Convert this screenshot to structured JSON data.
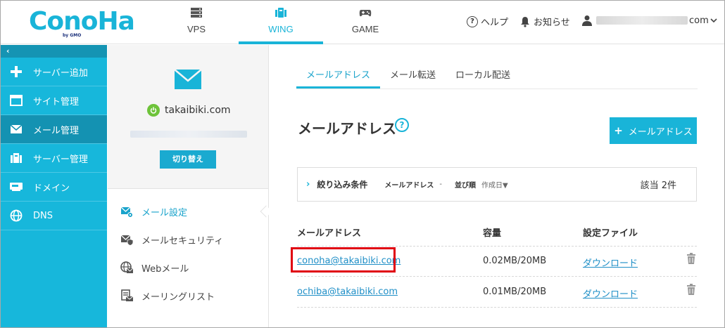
{
  "header": {
    "logo_text": "ConoHa",
    "logo_sub": "by GMO",
    "nav": [
      {
        "label": "VPS",
        "icon": "server-icon"
      },
      {
        "label": "WING",
        "icon": "wing-icon"
      },
      {
        "label": "GAME",
        "icon": "gamepad-icon"
      }
    ],
    "help_label": "ヘルプ",
    "notice_label": "お知らせ",
    "account_suffix": "com"
  },
  "sidebar": {
    "collapse_glyph": "‹",
    "items": [
      {
        "label": "サーバー追加",
        "icon": "plus-icon"
      },
      {
        "label": "サイト管理",
        "icon": "window-icon"
      },
      {
        "label": "メール管理",
        "icon": "envelope-icon"
      },
      {
        "label": "サーバー管理",
        "icon": "server-manage-icon"
      },
      {
        "label": "ドメイン",
        "icon": "domain-icon"
      },
      {
        "label": "DNS",
        "icon": "globe-icon"
      }
    ]
  },
  "subpanel": {
    "domain": "takaibiki.com",
    "switch_label": "切り替え",
    "menu": [
      {
        "label": "メール設定",
        "icon": "mail-settings-icon"
      },
      {
        "label": "メールセキュリティ",
        "icon": "mail-security-icon"
      },
      {
        "label": "Webメール",
        "icon": "webmail-icon"
      },
      {
        "label": "メーリングリスト",
        "icon": "mailing-list-icon"
      }
    ]
  },
  "main": {
    "tabs": [
      "メールアドレス",
      "メール転送",
      "ローカル配送"
    ],
    "title": "メールアドレス",
    "help_glyph": "?",
    "add_button": "メールアドレス",
    "filter": {
      "title": "絞り込み条件",
      "email_label": "メールアドレス",
      "email_value": "-",
      "sort_label": "並び順",
      "sort_value": "作成日▼",
      "count": "該当 2件"
    },
    "table": {
      "headers": [
        "メールアドレス",
        "容量",
        "設定ファイル"
      ],
      "rows": [
        {
          "email": "conoha@takaibiki.com",
          "capacity": "0.02MB/20MB",
          "file": "ダウンロード"
        },
        {
          "email": "ochiba@takaibiki.com",
          "capacity": "0.01MB/20MB",
          "file": "ダウンロード"
        }
      ]
    }
  },
  "colors": {
    "brand": "#19b4d8",
    "sidebar_active": "#1492b2",
    "highlight": "#e00010",
    "link": "#1f8fc7"
  }
}
